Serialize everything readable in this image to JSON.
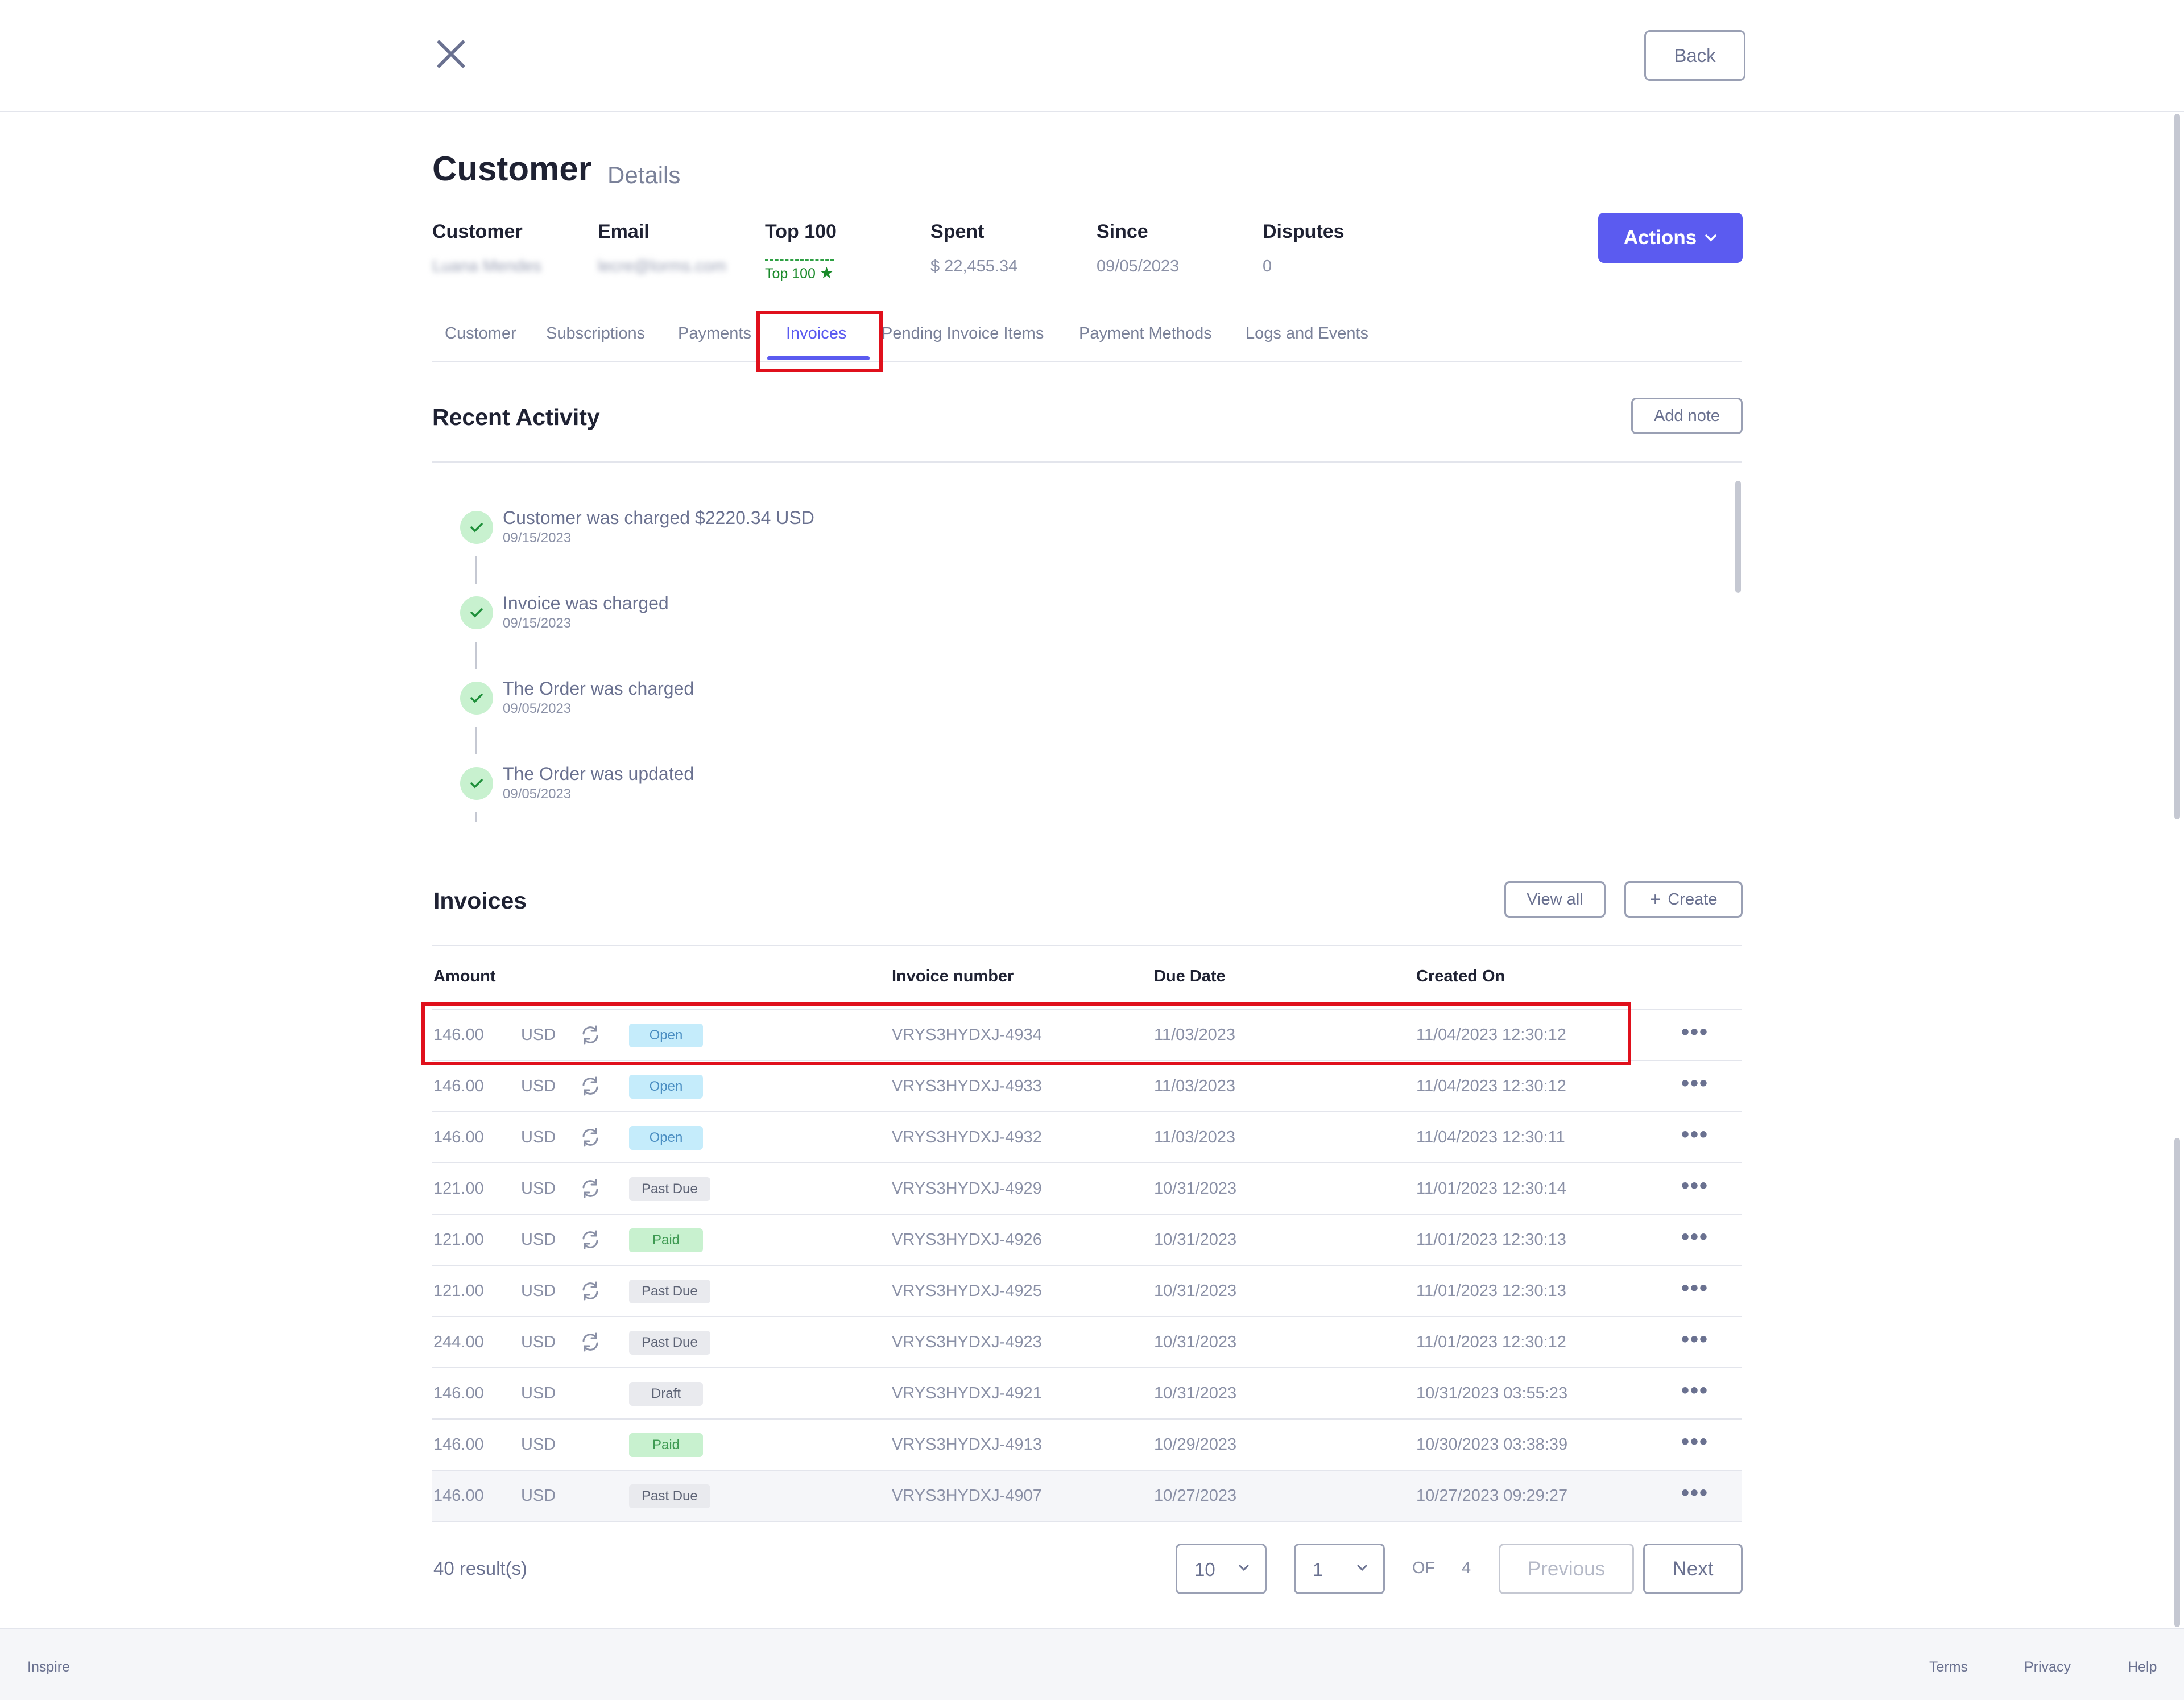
{
  "header": {
    "back_label": "Back"
  },
  "page": {
    "title": "Customer",
    "subtitle": "Details"
  },
  "meta": {
    "customer_label": "Customer",
    "customer_value": "Luana Mendes",
    "email_label": "Email",
    "email_value": "lecre@lorms.com",
    "top100_label": "Top 100",
    "top100_value": "Top 100",
    "spent_label": "Spent",
    "spent_value": "$ 22,455.34",
    "since_label": "Since",
    "since_value": "09/05/2023",
    "disputes_label": "Disputes",
    "disputes_value": "0"
  },
  "actions_label": "Actions",
  "tabs": [
    {
      "label": "Customer"
    },
    {
      "label": "Subscriptions"
    },
    {
      "label": "Payments"
    },
    {
      "label": "Invoices"
    },
    {
      "label": "Pending Invoice Items"
    },
    {
      "label": "Payment Methods"
    },
    {
      "label": "Logs and Events"
    }
  ],
  "activity": {
    "title": "Recent Activity",
    "add_note_label": "Add note",
    "items": [
      {
        "title": "Customer was charged $2220.34 USD",
        "date": "09/15/2023"
      },
      {
        "title": "Invoice was charged",
        "date": "09/15/2023"
      },
      {
        "title": "The Order was charged",
        "date": "09/05/2023"
      },
      {
        "title": "The Order was updated",
        "date": "09/05/2023"
      }
    ]
  },
  "invoices": {
    "title": "Invoices",
    "view_all_label": "View all",
    "create_label": "Create",
    "columns": {
      "amount": "Amount",
      "invoice_number": "Invoice number",
      "due_date": "Due Date",
      "created_on": "Created On"
    },
    "rows": [
      {
        "amount": "146.00",
        "currency": "USD",
        "status": "Open",
        "number": "VRYS3HYDXJ-4934",
        "due": "11/03/2023",
        "created": "11/04/2023 12:30:12"
      },
      {
        "amount": "146.00",
        "currency": "USD",
        "status": "Open",
        "number": "VRYS3HYDXJ-4933",
        "due": "11/03/2023",
        "created": "11/04/2023 12:30:12"
      },
      {
        "amount": "146.00",
        "currency": "USD",
        "status": "Open",
        "number": "VRYS3HYDXJ-4932",
        "due": "11/03/2023",
        "created": "11/04/2023 12:30:11"
      },
      {
        "amount": "121.00",
        "currency": "USD",
        "status": "Past Due",
        "number": "VRYS3HYDXJ-4929",
        "due": "10/31/2023",
        "created": "11/01/2023 12:30:14"
      },
      {
        "amount": "121.00",
        "currency": "USD",
        "status": "Paid",
        "number": "VRYS3HYDXJ-4926",
        "due": "10/31/2023",
        "created": "11/01/2023 12:30:13"
      },
      {
        "amount": "121.00",
        "currency": "USD",
        "status": "Past Due",
        "number": "VRYS3HYDXJ-4925",
        "due": "10/31/2023",
        "created": "11/01/2023 12:30:13"
      },
      {
        "amount": "244.00",
        "currency": "USD",
        "status": "Past Due",
        "number": "VRYS3HYDXJ-4923",
        "due": "10/31/2023",
        "created": "11/01/2023 12:30:12"
      },
      {
        "amount": "146.00",
        "currency": "USD",
        "status": "Draft",
        "number": "VRYS3HYDXJ-4921",
        "due": "10/31/2023",
        "created": "10/31/2023 03:55:23"
      },
      {
        "amount": "146.00",
        "currency": "USD",
        "status": "Paid",
        "number": "VRYS3HYDXJ-4913",
        "due": "10/29/2023",
        "created": "10/30/2023 03:38:39"
      },
      {
        "amount": "146.00",
        "currency": "USD",
        "status": "Past Due",
        "number": "VRYS3HYDXJ-4907",
        "due": "10/27/2023",
        "created": "10/27/2023 09:29:27"
      }
    ]
  },
  "pagination": {
    "results": "40 result(s)",
    "page_size": "10",
    "page": "1",
    "of_label": "OF",
    "total_pages": "4",
    "previous_label": "Previous",
    "next_label": "Next"
  },
  "footer": {
    "brand": "Inspire",
    "terms": "Terms",
    "privacy": "Privacy",
    "help": "Help"
  }
}
